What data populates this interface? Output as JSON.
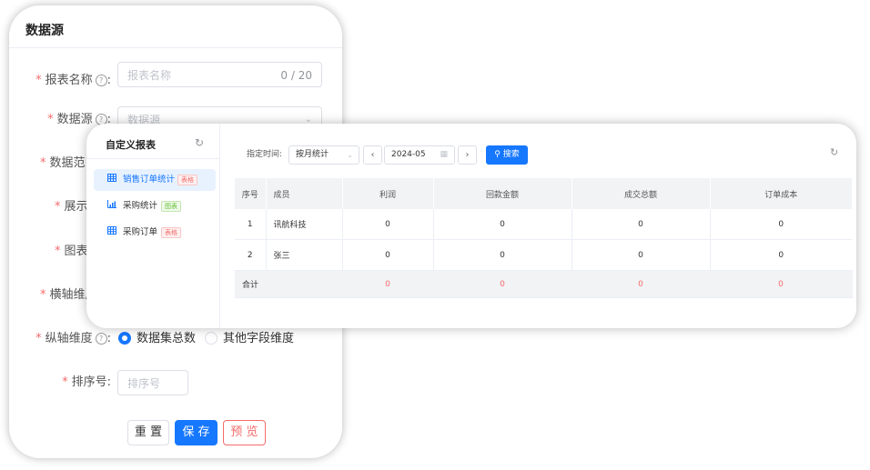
{
  "form": {
    "title": "数据源",
    "fields": [
      {
        "label": "报表名称",
        "placeholder": "报表名称",
        "counter": "0 / 20"
      },
      {
        "label": "数据源",
        "placeholder": "数据源"
      },
      {
        "label": "数据范"
      },
      {
        "label": "展示"
      },
      {
        "label": "图表"
      },
      {
        "label": "横轴维度"
      }
    ],
    "y_axis": {
      "label": "纵轴维度",
      "option_selected": "数据集总数",
      "option_other": "其他字段维度"
    },
    "sort": {
      "label": "排序号",
      "placeholder": "排序号"
    },
    "buttons": {
      "reset": "重 置",
      "save": "保 存",
      "preview": "预 览"
    },
    "colon": ":"
  },
  "report": {
    "sidebar": {
      "title": "自定义报表",
      "items": [
        {
          "label": "销售订单统计",
          "tag": "表格",
          "tag_color": "red",
          "icon": "table-icon",
          "active": true
        },
        {
          "label": "采购统计",
          "tag": "图表",
          "tag_color": "green",
          "icon": "bar-chart-icon",
          "active": false
        },
        {
          "label": "采购订单",
          "tag": "表格",
          "tag_color": "red",
          "icon": "table-icon",
          "active": false
        }
      ]
    },
    "toolbar": {
      "time_label": "指定时间:",
      "mode": "按月统计",
      "date": "2024-05",
      "search": "搜索"
    },
    "table": {
      "headers": [
        "序号",
        "成员",
        "利润",
        "回款金额",
        "成交总额",
        "订单成本"
      ],
      "rows": [
        [
          "1",
          "讯航科技",
          "0",
          "0",
          "0",
          "0"
        ],
        [
          "2",
          "张三",
          "0",
          "0",
          "0",
          "0"
        ]
      ],
      "total": [
        "合计",
        "",
        "0",
        "0",
        "0",
        "0"
      ]
    }
  },
  "colors": {
    "primary": "#1677ff",
    "danger": "#f56c6c",
    "success": "#67c23a"
  }
}
